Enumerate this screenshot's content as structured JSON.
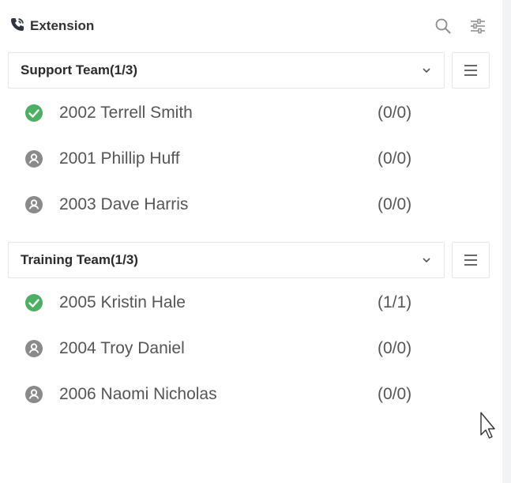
{
  "header": {
    "title": "Extension",
    "icons": [
      "phone-icon",
      "search-icon",
      "filter-settings-icon"
    ]
  },
  "groups": [
    {
      "name": "Support Team(1/3)",
      "members": [
        {
          "label": "2002 Terrell Smith",
          "count": "(0/0)",
          "status": "online"
        },
        {
          "label": "2001 Phillip Huff",
          "count": "(0/0)",
          "status": "offline"
        },
        {
          "label": "2003 Dave Harris",
          "count": "(0/0)",
          "status": "offline"
        }
      ]
    },
    {
      "name": "Training Team(1/3)",
      "members": [
        {
          "label": "2005 Kristin Hale",
          "count": "(1/1)",
          "status": "online"
        },
        {
          "label": "2004 Troy Daniel",
          "count": "(0/0)",
          "status": "offline"
        },
        {
          "label": "2006 Naomi Nicholas",
          "count": "(0/0)",
          "status": "offline"
        }
      ]
    }
  ],
  "colors": {
    "online": "#4caf64",
    "offline": "#8a8a8a",
    "border": "#e6e6e6"
  }
}
